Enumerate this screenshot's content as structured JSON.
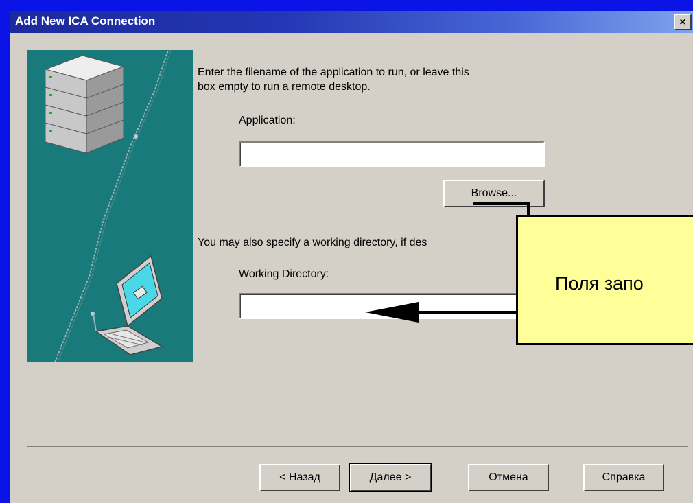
{
  "window": {
    "title": "Add New ICA Connection",
    "close_label": "×"
  },
  "content": {
    "intro_line1": "Enter the filename of the application to run, or leave this",
    "intro_line2": "box empty to run a remote desktop.",
    "application_label": "Application:",
    "application_value": "",
    "browse_label": "Browse...",
    "working_dir_intro": "You may also specify a working directory, if des",
    "working_dir_label": "Working Directory:",
    "working_dir_value": ""
  },
  "buttons": {
    "back": "< Назад",
    "next": "Далее >",
    "cancel": "Отмена",
    "help": "Справка"
  },
  "callout": {
    "text": "Поля запо"
  },
  "colors": {
    "desktop": "#0a14e6",
    "dialog_bg": "#d4d0c8",
    "illustration_bg": "#187a7a",
    "callout_bg": "#ffff99"
  }
}
